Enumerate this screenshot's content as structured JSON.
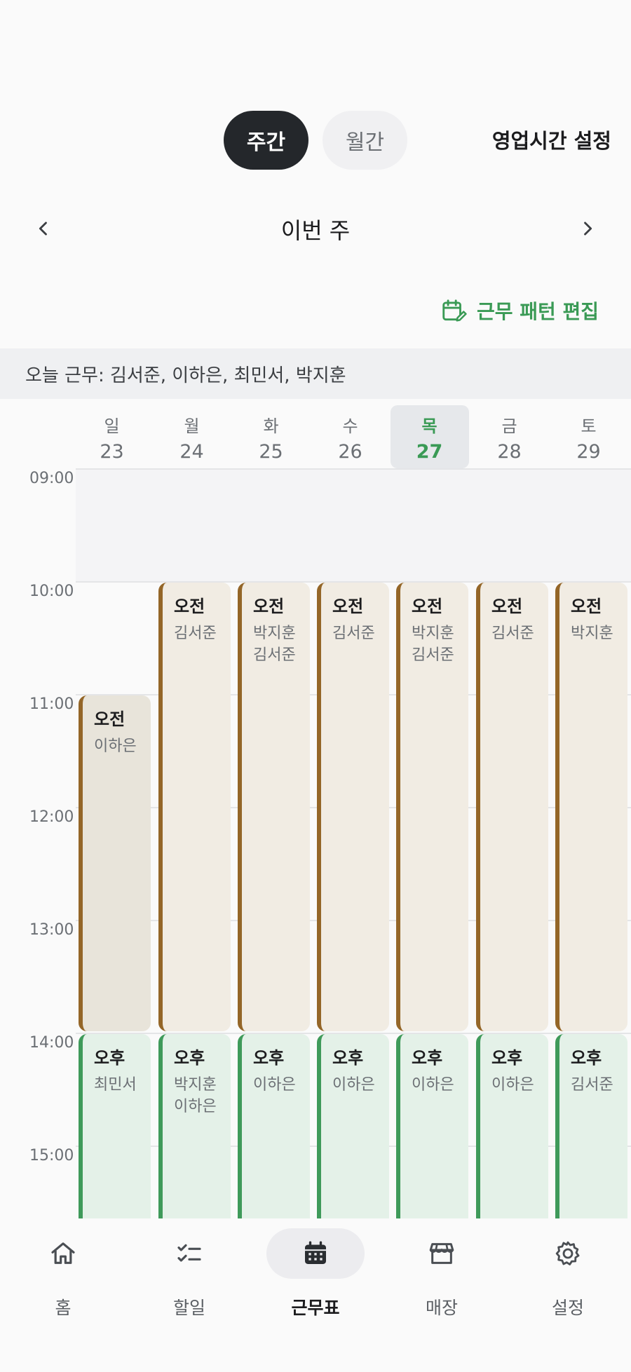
{
  "view_toggle": {
    "weekly": "주간",
    "monthly": "월간"
  },
  "business_hours_label": "영업시간 설정",
  "week_nav": {
    "title": "이번 주"
  },
  "pattern_edit_label": "근무 패턴 편집",
  "today_work": "오늘 근무: 김서준, 이하은, 최민서, 박지훈",
  "days": [
    {
      "name": "일",
      "date": "23",
      "today": false
    },
    {
      "name": "월",
      "date": "24",
      "today": false
    },
    {
      "name": "화",
      "date": "25",
      "today": false
    },
    {
      "name": "수",
      "date": "26",
      "today": false
    },
    {
      "name": "목",
      "date": "27",
      "today": true
    },
    {
      "name": "금",
      "date": "28",
      "today": false
    },
    {
      "name": "토",
      "date": "29",
      "today": false
    }
  ],
  "times": [
    "09:00",
    "10:00",
    "11:00",
    "12:00",
    "13:00",
    "14:00",
    "15:00"
  ],
  "shifts": [
    {
      "day": 0,
      "type": "am",
      "title": "오전",
      "names": [
        "이하은"
      ],
      "start": "11:00",
      "end": "14:00"
    },
    {
      "day": 1,
      "type": "am",
      "title": "오전",
      "names": [
        "김서준"
      ],
      "start": "10:00",
      "end": "14:00"
    },
    {
      "day": 2,
      "type": "am",
      "title": "오전",
      "names": [
        "박지훈",
        "김서준"
      ],
      "start": "10:00",
      "end": "14:00"
    },
    {
      "day": 3,
      "type": "am",
      "title": "오전",
      "names": [
        "김서준"
      ],
      "start": "10:00",
      "end": "14:00"
    },
    {
      "day": 4,
      "type": "am",
      "title": "오전",
      "names": [
        "박지훈",
        "김서준"
      ],
      "start": "10:00",
      "end": "14:00"
    },
    {
      "day": 5,
      "type": "am",
      "title": "오전",
      "names": [
        "김서준"
      ],
      "start": "10:00",
      "end": "14:00"
    },
    {
      "day": 6,
      "type": "am",
      "title": "오전",
      "names": [
        "박지훈"
      ],
      "start": "10:00",
      "end": "14:00"
    },
    {
      "day": 0,
      "type": "pm",
      "title": "오후",
      "names": [
        "최민서"
      ],
      "start": "14:00"
    },
    {
      "day": 1,
      "type": "pm",
      "title": "오후",
      "names": [
        "박지훈",
        "이하은"
      ],
      "start": "14:00"
    },
    {
      "day": 2,
      "type": "pm",
      "title": "오후",
      "names": [
        "이하은"
      ],
      "start": "14:00"
    },
    {
      "day": 3,
      "type": "pm",
      "title": "오후",
      "names": [
        "이하은"
      ],
      "start": "14:00"
    },
    {
      "day": 4,
      "type": "pm",
      "title": "오후",
      "names": [
        "이하은"
      ],
      "start": "14:00"
    },
    {
      "day": 5,
      "type": "pm",
      "title": "오후",
      "names": [
        "이하은"
      ],
      "start": "14:00"
    },
    {
      "day": 6,
      "type": "pm",
      "title": "오후",
      "names": [
        "김서준"
      ],
      "start": "14:00"
    }
  ],
  "bottom_nav": [
    {
      "label": "홈",
      "icon": "home-icon",
      "active": false
    },
    {
      "label": "할일",
      "icon": "checklist-icon",
      "active": false
    },
    {
      "label": "근무표",
      "icon": "calendar-icon",
      "active": true
    },
    {
      "label": "매장",
      "icon": "store-icon",
      "active": false
    },
    {
      "label": "설정",
      "icon": "gear-icon",
      "active": false
    }
  ],
  "colors": {
    "accent_green": "#3a9a55",
    "am_bar": "#946628",
    "pm_bar": "#3f9a5a",
    "dark": "#24272b"
  }
}
